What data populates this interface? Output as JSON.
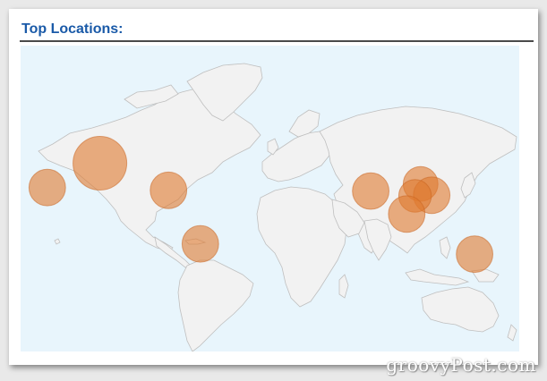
{
  "widget": {
    "title": "Top Locations:"
  },
  "colors": {
    "title": "#1a5aa8",
    "ocean": "#e8f5fc",
    "land": "#f2f2f2",
    "border": "#bfbfbf",
    "marker": "#e07a2e"
  },
  "markers": [
    {
      "name": "hawaii",
      "lat": 20.5,
      "lon": -157.5,
      "weight": 0.75
    },
    {
      "name": "california",
      "lat": 36.5,
      "lon": -119.5,
      "weight": 1.0
    },
    {
      "name": "caribbean",
      "lat": 18.5,
      "lon": -70.0,
      "weight": 0.75
    },
    {
      "name": "brazil",
      "lat": -21.0,
      "lon": -47.0,
      "weight": 0.75
    },
    {
      "name": "india",
      "lat": 18.0,
      "lon": 76.0,
      "weight": 0.75
    },
    {
      "name": "china-south",
      "lat": 23.0,
      "lon": 112.0,
      "weight": 0.72
    },
    {
      "name": "philippines",
      "lat": 15.0,
      "lon": 120.0,
      "weight": 0.75
    },
    {
      "name": "vietnam",
      "lat": 14.5,
      "lon": 108.0,
      "weight": 0.68
    },
    {
      "name": "indonesia",
      "lat": 1.0,
      "lon": 102.0,
      "weight": 0.75
    },
    {
      "name": "australia-east",
      "lat": -28.0,
      "lon": 151.0,
      "weight": 0.75
    }
  ],
  "watermark": "groovyPost.com"
}
